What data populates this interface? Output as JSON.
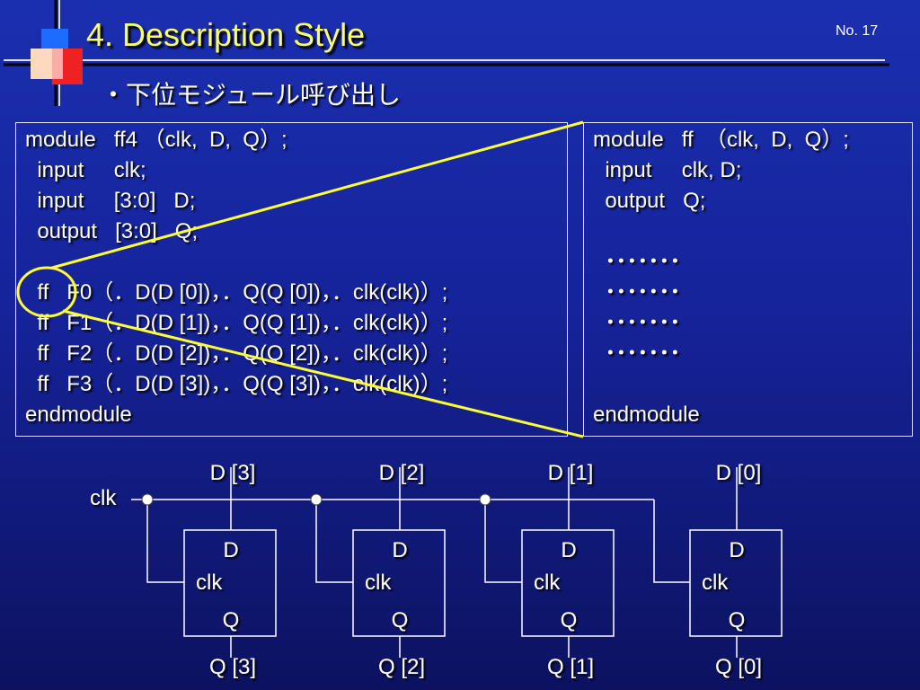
{
  "slide": {
    "title": "4. Description Style",
    "slide_number": "No. 17",
    "subtitle": "・下位モジュール呼び出し"
  },
  "left_code": {
    "lines": [
      "module   ff4 （clk,  D,  Q）;",
      "  input     clk;",
      "  input     [3:0]   D;",
      "  output   [3:0]   Q;",
      "",
      "  ff   F0（．D(D [0])，．Q(Q [0])，．clk(clk)）;",
      "  ff   F1（．D(D [1])，．Q(Q [1])，．clk(clk)）;",
      "  ff   F2（．D(D [2])，．Q(Q [2])，．clk(clk)）;",
      "  ff   F3（．D(D [3])，．Q(Q [3])，．clk(clk)）;",
      "endmodule"
    ]
  },
  "right_code": {
    "lines": [
      "module   ff  （clk,  D,  Q）;",
      "  input     clk, D;",
      "  output   Q;",
      "",
      "  ･･･････",
      "  ･･･････",
      "  ･･･････",
      "  ･･･････",
      "",
      "endmodule"
    ]
  },
  "diagram": {
    "clk_label": "clk",
    "flipflops": [
      {
        "d_in": "D [3]",
        "q_out": "Q [3]",
        "pin_d": "D",
        "pin_clk": "clk",
        "pin_q": "Q"
      },
      {
        "d_in": "D [2]",
        "q_out": "Q [2]",
        "pin_d": "D",
        "pin_clk": "clk",
        "pin_q": "Q"
      },
      {
        "d_in": "D [1]",
        "q_out": "Q [1]",
        "pin_d": "D",
        "pin_clk": "clk",
        "pin_q": "Q"
      },
      {
        "d_in": "D [0]",
        "q_out": "Q [0]",
        "pin_d": "D",
        "pin_clk": "clk",
        "pin_q": "Q"
      }
    ]
  },
  "colors": {
    "title": "#ffff66",
    "highlight": "#ffff33",
    "background": "#1a2fb0"
  }
}
